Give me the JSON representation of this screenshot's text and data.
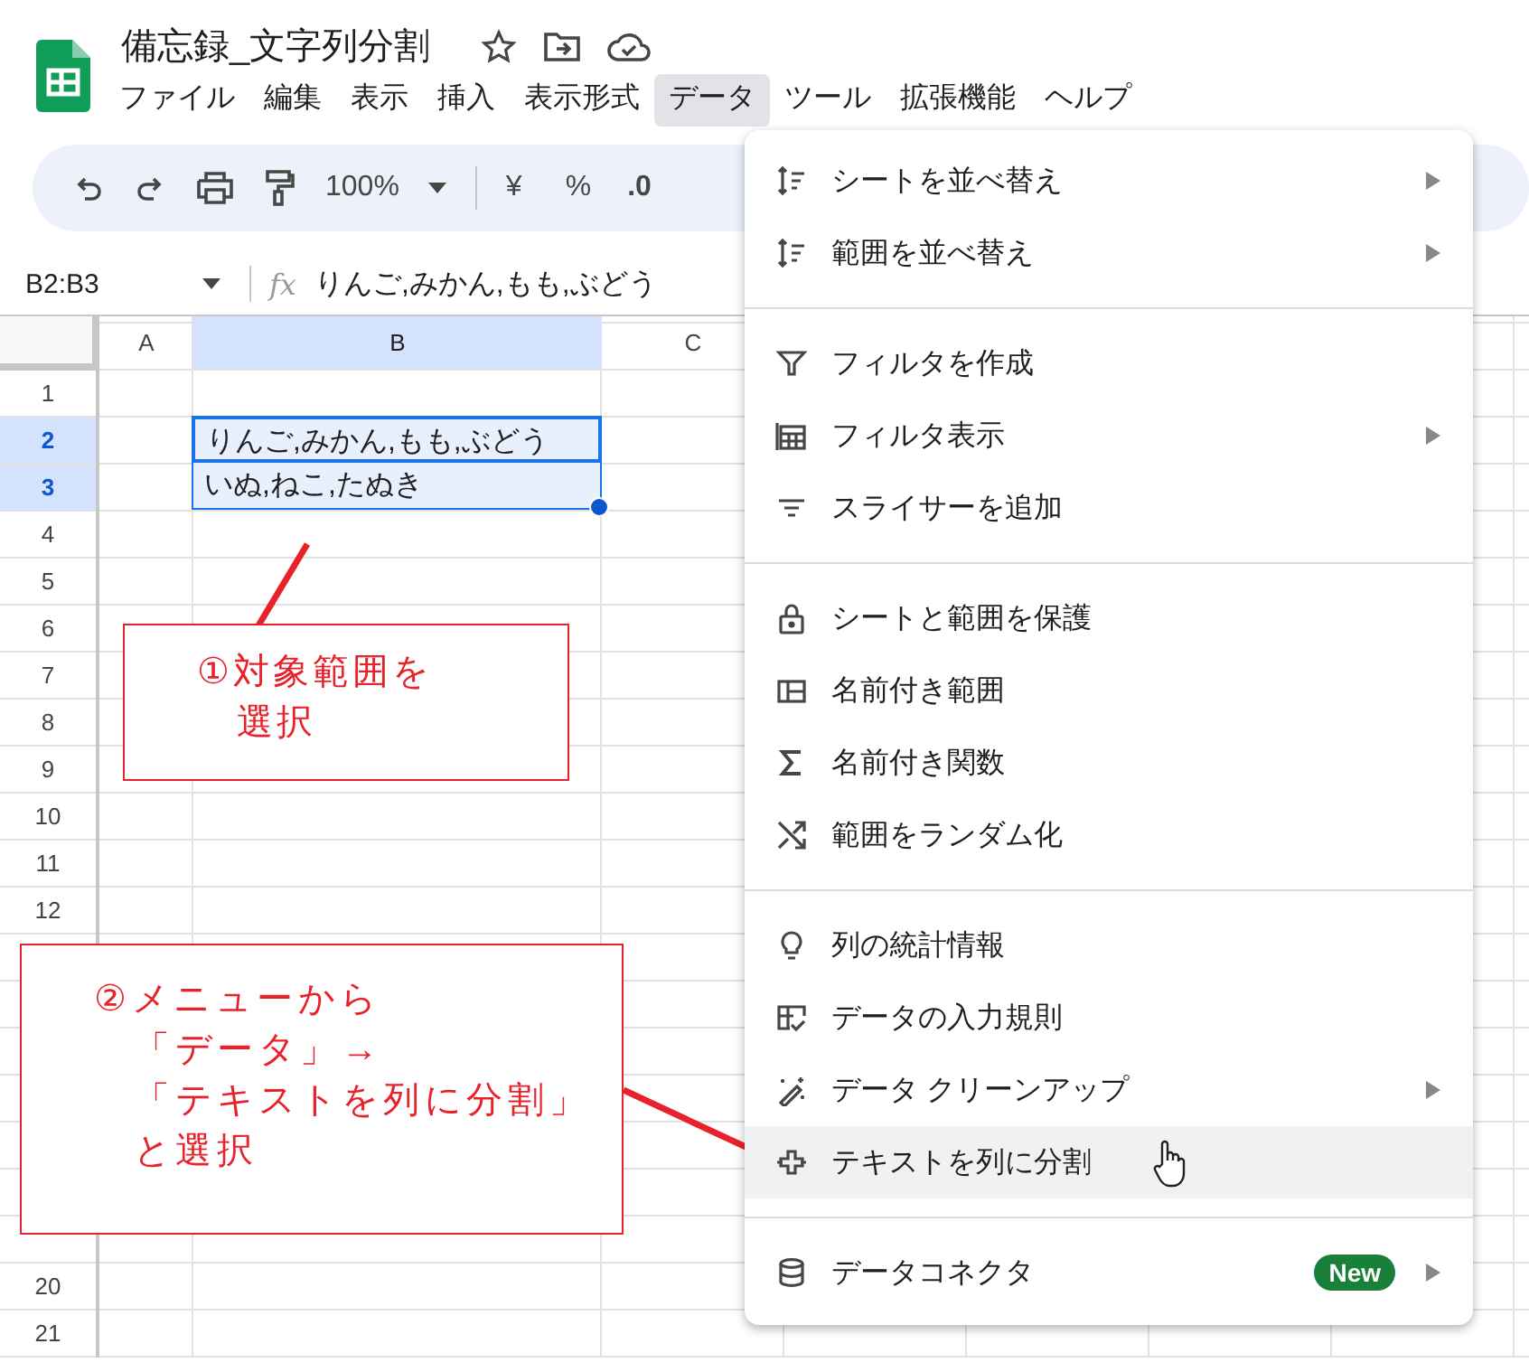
{
  "document": {
    "title": "備忘録_文字列分割"
  },
  "menubar": [
    {
      "label": "ファイル",
      "selected": false
    },
    {
      "label": "編集",
      "selected": false
    },
    {
      "label": "表示",
      "selected": false
    },
    {
      "label": "挿入",
      "selected": false
    },
    {
      "label": "表示形式",
      "selected": false
    },
    {
      "label": "データ",
      "selected": true
    },
    {
      "label": "ツール",
      "selected": false
    },
    {
      "label": "拡張機能",
      "selected": false
    },
    {
      "label": "ヘルプ",
      "selected": false
    }
  ],
  "toolbar": {
    "zoom": "100%",
    "currency": "¥",
    "percent": "%",
    "decimal": ".0"
  },
  "formula_bar": {
    "name_box": "B2:B3",
    "fx": "fx",
    "value": "りんご,みかん,もも,ぶどう"
  },
  "grid": {
    "columns": [
      {
        "label": "A",
        "selected": false
      },
      {
        "label": "B",
        "selected": true
      },
      {
        "label": "C",
        "selected": false
      }
    ],
    "rows_top": [
      {
        "label": "1",
        "selected": false
      },
      {
        "label": "2",
        "selected": true,
        "column_b": "りんご,みかん,もも,ぶどう"
      },
      {
        "label": "3",
        "selected": true,
        "column_b": "いぬ,ねこ,たぬき"
      },
      {
        "label": "4",
        "selected": false
      },
      {
        "label": "5",
        "selected": false
      },
      {
        "label": "6",
        "selected": false
      },
      {
        "label": "7",
        "selected": false
      },
      {
        "label": "8",
        "selected": false
      },
      {
        "label": "9",
        "selected": false
      },
      {
        "label": "10",
        "selected": false
      },
      {
        "label": "11",
        "selected": false
      },
      {
        "label": "12",
        "selected": false
      }
    ],
    "rows_bottom": [
      {
        "label": "20",
        "selected": false
      },
      {
        "label": "21",
        "selected": false
      }
    ]
  },
  "data_menu": [
    {
      "kind": "item",
      "label": "シートを並べ替え",
      "submenu": true,
      "hovered": false
    },
    {
      "kind": "item",
      "label": "範囲を並べ替え",
      "submenu": true,
      "hovered": false
    },
    {
      "kind": "divider"
    },
    {
      "kind": "item",
      "label": "フィルタを作成",
      "submenu": false,
      "hovered": false
    },
    {
      "kind": "item",
      "label": "フィルタ表示",
      "submenu": true,
      "hovered": false
    },
    {
      "kind": "item",
      "label": "スライサーを追加",
      "submenu": false,
      "hovered": false
    },
    {
      "kind": "divider"
    },
    {
      "kind": "item",
      "label": "シートと範囲を保護",
      "submenu": false,
      "hovered": false
    },
    {
      "kind": "item",
      "label": "名前付き範囲",
      "submenu": false,
      "hovered": false
    },
    {
      "kind": "item",
      "label": "名前付き関数",
      "submenu": false,
      "hovered": false
    },
    {
      "kind": "item",
      "label": "範囲をランダム化",
      "submenu": false,
      "hovered": false
    },
    {
      "kind": "divider"
    },
    {
      "kind": "item",
      "label": "列の統計情報",
      "submenu": false,
      "hovered": false
    },
    {
      "kind": "item",
      "label": "データの入力規則",
      "submenu": false,
      "hovered": false
    },
    {
      "kind": "item",
      "label": "データ クリーンアップ",
      "submenu": true,
      "hovered": false
    },
    {
      "kind": "item",
      "label": "テキストを列に分割",
      "submenu": false,
      "hovered": true
    },
    {
      "kind": "divider"
    },
    {
      "kind": "item",
      "label": "データコネクタ",
      "submenu": true,
      "hovered": false,
      "badge": "New"
    }
  ],
  "callouts": [
    {
      "lines": [
        "①対象範囲を",
        "選択"
      ]
    },
    {
      "lines": [
        "②メニューから",
        "「データ」→",
        "「テキストを列に分割」",
        "と選択"
      ]
    }
  ]
}
